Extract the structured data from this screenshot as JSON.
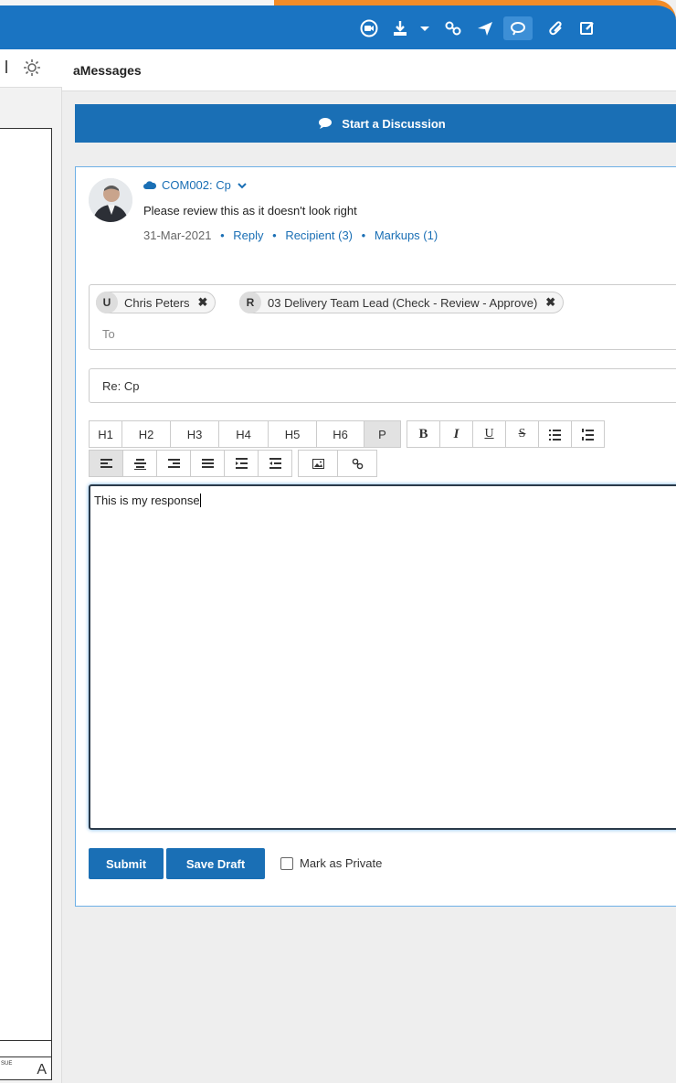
{
  "panel": {
    "title": "aMessages"
  },
  "start_discussion": {
    "label": "Start a Discussion"
  },
  "message": {
    "heading": "COM002: Cp",
    "text": "Please review this as it doesn't look right",
    "date": "31-Mar-2021",
    "reply": "Reply",
    "recipients": "Recipient (3)",
    "markups": "Markups (1)"
  },
  "to": {
    "chips": [
      {
        "badge": "U",
        "label": "Chris Peters"
      },
      {
        "badge": "R",
        "label": "03 Delivery Team Lead (Check - Review - Approve)"
      }
    ],
    "placeholder": "To",
    "remove_glyph": "✖"
  },
  "subject": {
    "value": "Re: Cp"
  },
  "toolbar": {
    "headings": [
      "H1",
      "H2",
      "H3",
      "H4",
      "H5",
      "H6",
      "P"
    ],
    "format": [
      "B",
      "I",
      "U",
      "S"
    ]
  },
  "editor": {
    "value": "This is my response"
  },
  "actions": {
    "submit": "Submit",
    "save_draft": "Save Draft",
    "private": "Mark as Private"
  },
  "left": {
    "revision": "A",
    "issue_fragment": "SUE"
  },
  "colors": {
    "brand": "#1a74c2",
    "accent": "#f28c28",
    "button": "#1a6fb5"
  }
}
